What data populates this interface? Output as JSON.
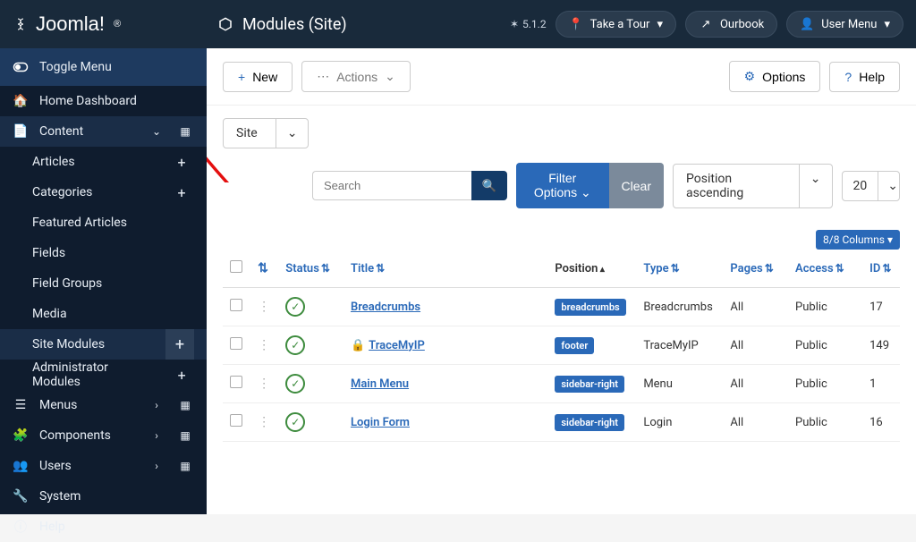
{
  "app": {
    "brand": "Joomla!",
    "brand_super": "®"
  },
  "page": {
    "title": "Modules (Site)"
  },
  "version": "5.1.2",
  "topbar": {
    "take_tour": "Take a Tour",
    "ourbook": "Ourbook",
    "user_menu": "User Menu"
  },
  "sidebar": {
    "toggle": "Toggle Menu",
    "home": "Home Dashboard",
    "content": "Content",
    "articles": "Articles",
    "categories": "Categories",
    "featured": "Featured Articles",
    "fields": "Fields",
    "field_groups": "Field Groups",
    "media": "Media",
    "site_modules": "Site Modules",
    "admin_modules": "Administrator Modules",
    "menus": "Menus",
    "components": "Components",
    "users": "Users",
    "system": "System",
    "help": "Help"
  },
  "toolbar": {
    "new": "New",
    "actions": "Actions",
    "options": "Options",
    "help": "Help"
  },
  "filters": {
    "client": "Site",
    "search_placeholder": "Search",
    "filter_options": "Filter Options",
    "clear": "Clear",
    "sort": "Position ascending",
    "limit": "20",
    "columns_badge": "8/8 Columns"
  },
  "table": {
    "headers": {
      "status": "Status",
      "title": "Title",
      "position": "Position",
      "type": "Type",
      "pages": "Pages",
      "access": "Access",
      "id": "ID"
    },
    "rows": [
      {
        "title": "Breadcrumbs",
        "locked": false,
        "position": "breadcrumbs",
        "type": "Breadcrumbs",
        "pages": "All",
        "access": "Public",
        "id": "17"
      },
      {
        "title": "TraceMyIP",
        "locked": true,
        "position": "footer",
        "type": "TraceMyIP",
        "pages": "All",
        "access": "Public",
        "id": "149"
      },
      {
        "title": "Main Menu",
        "locked": false,
        "position": "sidebar-right",
        "type": "Menu",
        "pages": "All",
        "access": "Public",
        "id": "1"
      },
      {
        "title": "Login Form",
        "locked": false,
        "position": "sidebar-right",
        "type": "Login",
        "pages": "All",
        "access": "Public",
        "id": "16"
      }
    ]
  }
}
